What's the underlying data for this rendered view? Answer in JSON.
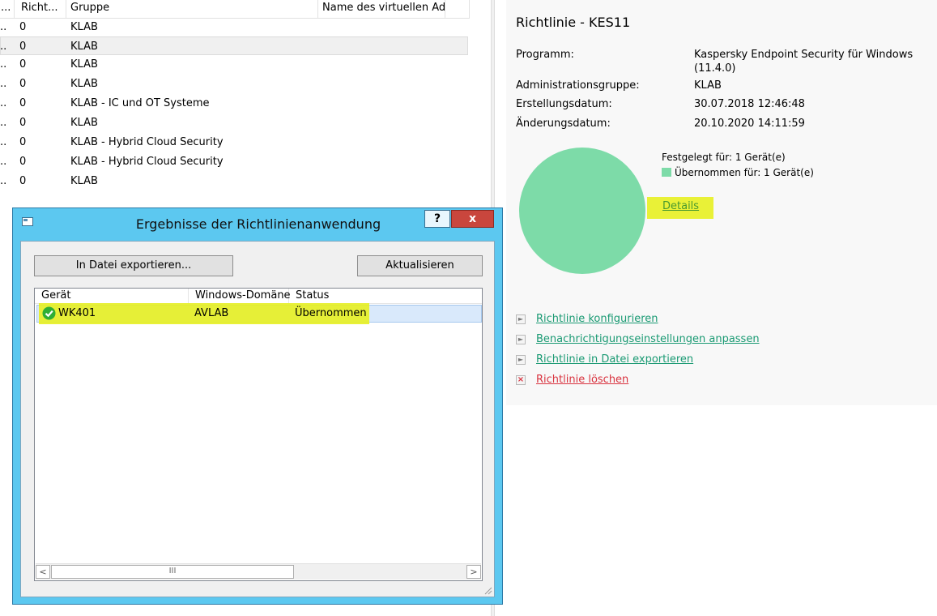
{
  "list": {
    "columns": [
      {
        "label": "..."
      },
      {
        "label": "Richt..."
      },
      {
        "label": "Gruppe"
      },
      {
        "label": "Name des virtuellen Ad..."
      }
    ],
    "rows": [
      {
        "c0": "..",
        "c1": "0",
        "group": "KLAB"
      },
      {
        "c0": "..",
        "c1": "0",
        "group": "KLAB"
      },
      {
        "c0": "..",
        "c1": "0",
        "group": "KLAB"
      },
      {
        "c0": "..",
        "c1": "0",
        "group": "KLAB"
      },
      {
        "c0": "..",
        "c1": "0",
        "group": "KLAB - IC und OT Systeme"
      },
      {
        "c0": "..",
        "c1": "0",
        "group": "KLAB"
      },
      {
        "c0": "..",
        "c1": "0",
        "group": "KLAB - Hybrid Cloud Security"
      },
      {
        "c0": "..",
        "c1": "0",
        "group": "KLAB - Hybrid Cloud Security"
      },
      {
        "c0": "..",
        "c1": "0",
        "group": "KLAB"
      }
    ]
  },
  "policy": {
    "title": "Richtlinie - KES11",
    "properties": [
      {
        "label": "Programm:",
        "value": "Kaspersky Endpoint Security für Windows",
        "value2": "(11.4.0)"
      },
      {
        "label": "Administrationsgruppe:",
        "value": "KLAB"
      },
      {
        "label": "Erstellungsdatum:",
        "value": "30.07.2018 12:46:48"
      },
      {
        "label": "Änderungsdatum:",
        "value": "20.10.2020 14:11:59"
      }
    ],
    "legend": {
      "defined": "Festgelegt für: 1 Gerät(e)",
      "applied": "Übernommen für: 1 Gerät(e)",
      "applied_color": "#7ddba8"
    },
    "details_link": "Details",
    "actions": [
      {
        "label": "Richtlinie konfigurieren",
        "icon": "play-arrow-icon"
      },
      {
        "label": "Benachrichtigungseinstellungen anpassen",
        "icon": "play-arrow-icon"
      },
      {
        "label": "Richtlinie in Datei exportieren",
        "icon": "play-arrow-icon"
      },
      {
        "label": "Richtlinie löschen",
        "icon": "delete-x-icon"
      }
    ]
  },
  "chart_data": {
    "type": "pie",
    "categories": [
      "Übernommen für: 1 Gerät(e)"
    ],
    "values": [
      1
    ],
    "colors": [
      "#7ddba8"
    ]
  },
  "dialog": {
    "title": "Ergebnisse der Richtlinienanwendung",
    "help_label": "?",
    "close_label": "x",
    "export_button": "In Datei exportieren...",
    "refresh_button": "Aktualisieren",
    "columns": [
      {
        "label": "Gerät"
      },
      {
        "label": "Windows-Domäne"
      },
      {
        "label": "Status"
      }
    ],
    "rows": [
      {
        "device": "WK401",
        "domain": "AVLAB",
        "status": "Übernommen"
      }
    ],
    "scroll_left": "<",
    "scroll_right": ">",
    "scroll_thumb": "III"
  }
}
